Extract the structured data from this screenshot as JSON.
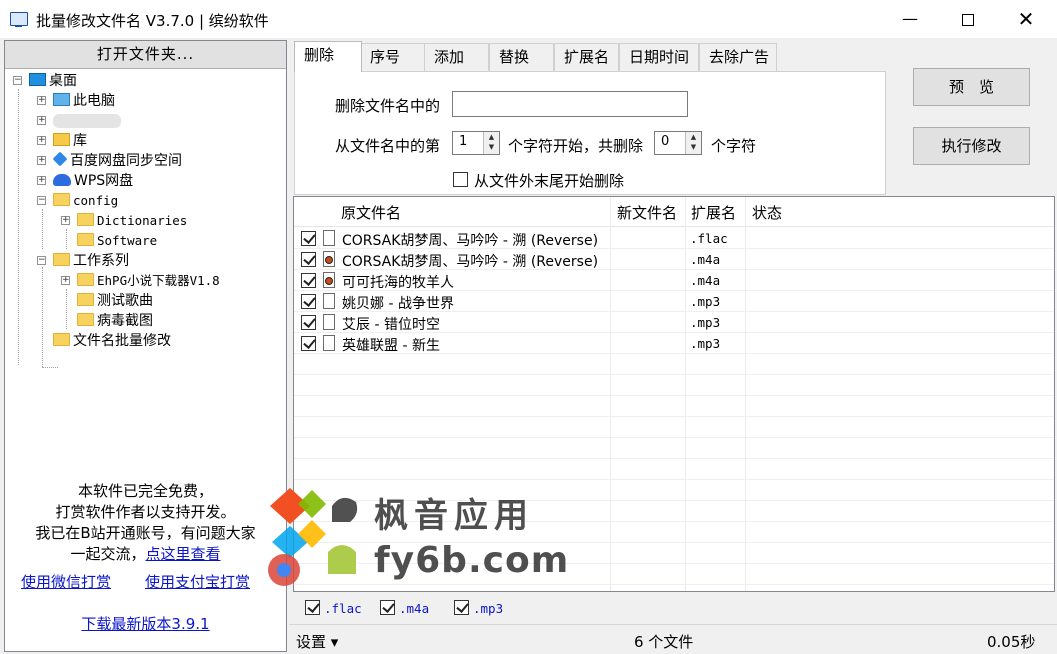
{
  "window": {
    "title": "批量修改文件名 V3.7.0 | 缤纷软件",
    "minimize": "—",
    "maximize": "",
    "close": "✕"
  },
  "left": {
    "open_folder": "打开文件夹...",
    "tree": {
      "desktop": "桌面",
      "this_pc": "此电脑",
      "library": "库",
      "baidu": "百度网盘同步空间",
      "wps": "WPS网盘",
      "config": "config",
      "dictionaries": "Dictionaries",
      "software": "Software",
      "work": "工作系列",
      "ehpg": "EhPG小说下载器V1.8",
      "test_songs": "测试歌曲",
      "virus": "病毒截图",
      "rename": "文件名批量修改"
    },
    "promo": {
      "line1": "本软件已完全免费，",
      "line2": "打赏软件作者以支持开发。",
      "line3": "我已在B站开通账号，有问题大家",
      "line4_text": "一起交流，",
      "line4_link": "点这里查看",
      "wechat": "使用微信打赏",
      "alipay": "使用支付宝打赏",
      "download": "下载最新版本3.9.1"
    }
  },
  "tabs": [
    "删除",
    "序号",
    "添加",
    "替换",
    "扩展名",
    "日期时间",
    "去除广告"
  ],
  "delete_tab": {
    "contains_label": "删除文件名中的",
    "contains_value": "",
    "from_label": "从文件名中的第",
    "from_value": "1",
    "start_label": "个字符开始，共删除",
    "count_value": "0",
    "count_label": "个字符",
    "from_end_label": "从文件外末尾开始删除"
  },
  "buttons": {
    "preview": "预　览",
    "execute": "执行修改"
  },
  "list": {
    "columns": [
      "原文件名",
      "新文件名",
      "扩展名",
      "状态"
    ],
    "rows": [
      {
        "name": "CORSAK胡梦周、马吟吟 - 溯 (Reverse)",
        "ext": ".flac",
        "icon": "document-icon"
      },
      {
        "name": "CORSAK胡梦周、马吟吟 - 溯 (Reverse)",
        "ext": ".m4a",
        "icon": "media-icon"
      },
      {
        "name": "可可托海的牧羊人",
        "ext": ".m4a",
        "icon": "media-icon"
      },
      {
        "name": "姚贝娜 - 战争世界",
        "ext": ".mp3",
        "icon": "document-icon"
      },
      {
        "name": "艾辰 - 错位时空",
        "ext": ".mp3",
        "icon": "document-icon"
      },
      {
        "name": "英雄联盟 - 新生",
        "ext": ".mp3",
        "icon": "document-icon"
      }
    ]
  },
  "filters": [
    ".flac",
    ".m4a",
    ".mp3"
  ],
  "status": {
    "settings": "设置 ▾",
    "count": "6 个文件",
    "time": "0.05秒"
  },
  "watermark": {
    "line1": "枫音应用",
    "line2": "fy6b.com"
  }
}
